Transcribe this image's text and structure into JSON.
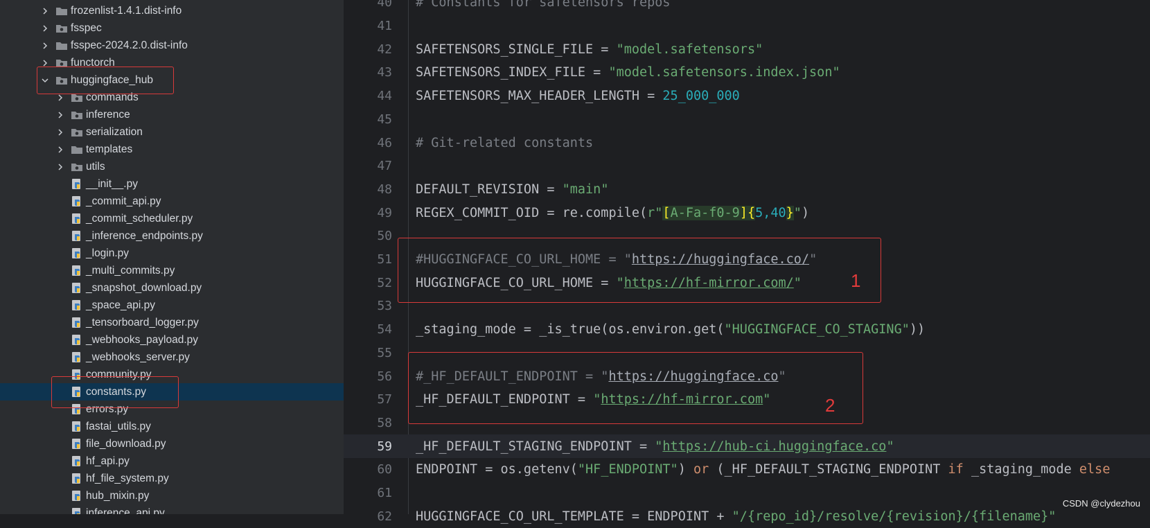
{
  "file_tree": {
    "items": [
      {
        "label": "frozenlist-1.4.1.dist-info",
        "type": "folder",
        "indent": 0,
        "expanded": false
      },
      {
        "label": "fsspec",
        "type": "folder-pkg",
        "indent": 0,
        "expanded": false
      },
      {
        "label": "fsspec-2024.2.0.dist-info",
        "type": "folder",
        "indent": 0,
        "expanded": false
      },
      {
        "label": "functorch",
        "type": "folder-pkg",
        "indent": 0,
        "expanded": false
      },
      {
        "label": "huggingface_hub",
        "type": "folder-pkg",
        "indent": 0,
        "expanded": true
      },
      {
        "label": "commands",
        "type": "folder-pkg",
        "indent": 1,
        "expanded": false
      },
      {
        "label": "inference",
        "type": "folder-pkg",
        "indent": 1,
        "expanded": false
      },
      {
        "label": "serialization",
        "type": "folder-pkg",
        "indent": 1,
        "expanded": false
      },
      {
        "label": "templates",
        "type": "folder",
        "indent": 1,
        "expanded": false
      },
      {
        "label": "utils",
        "type": "folder-pkg",
        "indent": 1,
        "expanded": false
      },
      {
        "label": "__init__.py",
        "type": "py",
        "indent": 1
      },
      {
        "label": "_commit_api.py",
        "type": "py",
        "indent": 1
      },
      {
        "label": "_commit_scheduler.py",
        "type": "py",
        "indent": 1
      },
      {
        "label": "_inference_endpoints.py",
        "type": "py",
        "indent": 1
      },
      {
        "label": "_login.py",
        "type": "py",
        "indent": 1
      },
      {
        "label": "_multi_commits.py",
        "type": "py",
        "indent": 1
      },
      {
        "label": "_snapshot_download.py",
        "type": "py",
        "indent": 1
      },
      {
        "label": "_space_api.py",
        "type": "py",
        "indent": 1
      },
      {
        "label": "_tensorboard_logger.py",
        "type": "py",
        "indent": 1
      },
      {
        "label": "_webhooks_payload.py",
        "type": "py",
        "indent": 1
      },
      {
        "label": "_webhooks_server.py",
        "type": "py",
        "indent": 1
      },
      {
        "label": "community.py",
        "type": "py",
        "indent": 1
      },
      {
        "label": "constants.py",
        "type": "py",
        "indent": 1,
        "selected": true
      },
      {
        "label": "errors.py",
        "type": "py",
        "indent": 1
      },
      {
        "label": "fastai_utils.py",
        "type": "py",
        "indent": 1
      },
      {
        "label": "file_download.py",
        "type": "py",
        "indent": 1
      },
      {
        "label": "hf_api.py",
        "type": "py",
        "indent": 1
      },
      {
        "label": "hf_file_system.py",
        "type": "py",
        "indent": 1
      },
      {
        "label": "hub_mixin.py",
        "type": "py",
        "indent": 1
      },
      {
        "label": "inference_api.py",
        "type": "py",
        "indent": 1
      }
    ]
  },
  "editor": {
    "current_line": 59,
    "lines": [
      {
        "n": "40",
        "tokens": [
          {
            "t": "# Constants for safetensors repos",
            "c": "comment"
          }
        ]
      },
      {
        "n": "41",
        "tokens": []
      },
      {
        "n": "42",
        "tokens": [
          {
            "t": "SAFETENSORS_SINGLE_FILE = "
          },
          {
            "t": "\"model.safetensors\"",
            "c": "string"
          }
        ]
      },
      {
        "n": "43",
        "tokens": [
          {
            "t": "SAFETENSORS_INDEX_FILE = "
          },
          {
            "t": "\"model.safetensors.index.json\"",
            "c": "string"
          }
        ]
      },
      {
        "n": "44",
        "tokens": [
          {
            "t": "SAFETENSORS_MAX_HEADER_LENGTH = "
          },
          {
            "t": "25_000_000",
            "c": "number"
          }
        ]
      },
      {
        "n": "45",
        "tokens": []
      },
      {
        "n": "46",
        "tokens": [
          {
            "t": "# Git-related constants",
            "c": "comment"
          }
        ]
      },
      {
        "n": "47",
        "tokens": []
      },
      {
        "n": "48",
        "tokens": [
          {
            "t": "DEFAULT_REVISION = "
          },
          {
            "t": "\"main\"",
            "c": "string"
          }
        ]
      },
      {
        "n": "49",
        "tokens": [
          {
            "t": "REGEX_COMMIT_OID = re.compile("
          },
          {
            "t": "r\"",
            "c": "string"
          },
          {
            "t": "[",
            "c": "bracket"
          },
          {
            "t": "A-Fa-f0-9",
            "c": "regex"
          },
          {
            "t": "]",
            "c": "bracket"
          },
          {
            "t": "{",
            "c": "bracket"
          },
          {
            "t": "5,40",
            "c": "number"
          },
          {
            "t": "}",
            "c": "bracket"
          },
          {
            "t": "\"",
            "c": "string"
          },
          {
            "t": ")"
          }
        ]
      },
      {
        "n": "50",
        "tokens": []
      },
      {
        "n": "51",
        "tokens": [
          {
            "t": "#HUGGINGFACE_CO_URL_HOME = \"",
            "c": "comment"
          },
          {
            "t": "https://huggingface.co/",
            "c": "curl"
          },
          {
            "t": "\"",
            "c": "comment"
          }
        ]
      },
      {
        "n": "52",
        "tokens": [
          {
            "t": "HUGGINGFACE_CO_URL_HOME = "
          },
          {
            "t": "\"",
            "c": "string"
          },
          {
            "t": "https://hf-mirror.com/",
            "c": "url"
          },
          {
            "t": "\"",
            "c": "string"
          }
        ]
      },
      {
        "n": "53",
        "tokens": []
      },
      {
        "n": "54",
        "tokens": [
          {
            "t": "_staging_mode = _is_true(os.environ.get("
          },
          {
            "t": "\"HUGGINGFACE_CO_STAGING\"",
            "c": "string"
          },
          {
            "t": "))"
          }
        ]
      },
      {
        "n": "55",
        "tokens": []
      },
      {
        "n": "56",
        "tokens": [
          {
            "t": "#_HF_DEFAULT_ENDPOINT = \"",
            "c": "comment"
          },
          {
            "t": "https://huggingface.co",
            "c": "curl"
          },
          {
            "t": "\"",
            "c": "comment"
          }
        ]
      },
      {
        "n": "57",
        "tokens": [
          {
            "t": "_HF_DEFAULT_ENDPOINT = "
          },
          {
            "t": "\"",
            "c": "string"
          },
          {
            "t": "https://hf-mirror.com",
            "c": "url"
          },
          {
            "t": "\"",
            "c": "string"
          }
        ]
      },
      {
        "n": "58",
        "tokens": []
      },
      {
        "n": "59",
        "tokens": [
          {
            "t": "_HF_DEFAULT_STAGING_ENDPOINT = "
          },
          {
            "t": "\"",
            "c": "string"
          },
          {
            "t": "https://hub-ci.huggingface.co",
            "c": "url"
          },
          {
            "t": "\"",
            "c": "string"
          }
        ]
      },
      {
        "n": "60",
        "tokens": [
          {
            "t": "ENDPOINT = os.getenv("
          },
          {
            "t": "\"HF_ENDPOINT\"",
            "c": "string"
          },
          {
            "t": ") "
          },
          {
            "t": "or",
            "c": "keyword"
          },
          {
            "t": " (_HF_DEFAULT_STAGING_ENDPOINT "
          },
          {
            "t": "if",
            "c": "keyword"
          },
          {
            "t": " _staging_mode "
          },
          {
            "t": "else",
            "c": "keyword"
          }
        ]
      },
      {
        "n": "61",
        "tokens": []
      },
      {
        "n": "62",
        "tokens": [
          {
            "t": "HUGGINGFACE_CO_URL_TEMPLATE = ENDPOINT + "
          },
          {
            "t": "\"/{repo_id}/resolve/{revision}/{filename}\"",
            "c": "string"
          }
        ]
      }
    ]
  },
  "annotations": [
    {
      "label": "1"
    },
    {
      "label": "2"
    }
  ],
  "watermark": "CSDN @clydezhou",
  "colors": {
    "sidebar_bg": "#2b2d30",
    "editor_bg": "#1e1f22",
    "selection": "#0e3450",
    "annotation_red": "#d83a3a"
  }
}
